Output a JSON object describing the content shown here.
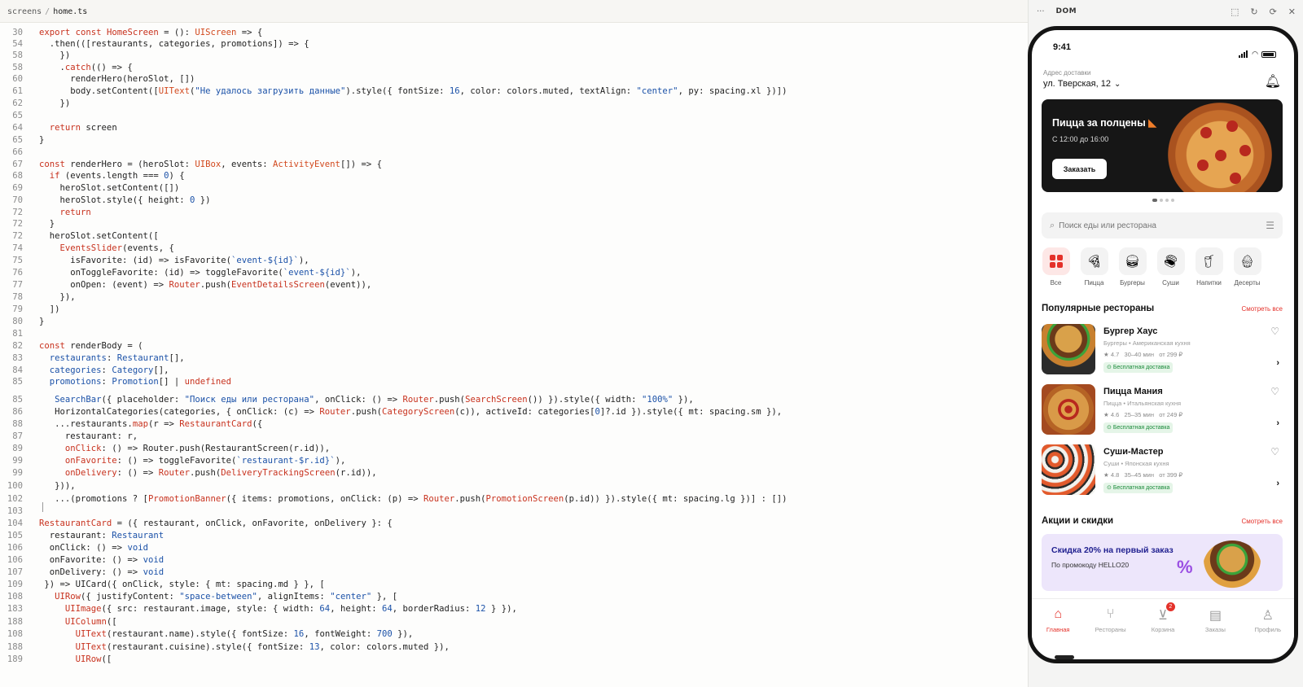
{
  "editor": {
    "breadcrumb": {
      "folder": "screens",
      "file": "home.ts"
    },
    "lines": [
      {
        "n": "30",
        "html": "<span class=\"kw\">export const</span> <span class=\"fn\">HomeScreen</span> = (): <span class=\"ty\">UIScreen</span> => {"
      },
      {
        "n": "54",
        "html": "  .then(([restaurants, categories, promotions]) => {"
      },
      {
        "n": "58",
        "html": "    })"
      },
      {
        "n": "58",
        "html": "    .<span class=\"fn\">catch</span>(() => {"
      },
      {
        "n": "60",
        "html": "      renderHero(heroSlot, [])"
      },
      {
        "n": "61",
        "html": "      body.setContent([<span class=\"ty\">UIText</span>(<span class=\"str\">\"Не удалось загрузить данные\"</span>).style({ fontSize: <span class=\"num\">16</span>, color: colors.muted, textAlign: <span class=\"str\">\"center\"</span>, py: spacing.xl })])"
      },
      {
        "n": "62",
        "html": "    })"
      },
      {
        "n": "65",
        "html": ""
      },
      {
        "n": "64",
        "html": "  <span class=\"kw\">return</span> screen"
      },
      {
        "n": "65",
        "html": "}"
      },
      {
        "n": "66",
        "html": ""
      },
      {
        "n": "67",
        "html": "<span class=\"kw\">const</span> renderHero = (heroSlot: <span class=\"ty\">UIBox</span>, events: <span class=\"ty\">ActivityEvent</span>[]) => {"
      },
      {
        "n": "68",
        "html": "  <span class=\"kw\">if</span> (events.length === <span class=\"num\">0</span>) {"
      },
      {
        "n": "69",
        "html": "    heroSlot.setContent([])"
      },
      {
        "n": "70",
        "html": "    heroSlot.style({ height: <span class=\"num\">0</span> })"
      },
      {
        "n": "72",
        "html": "    <span class=\"kw\">return</span>"
      },
      {
        "n": "72",
        "html": "  }"
      },
      {
        "n": "72",
        "html": "  heroSlot.setContent(["
      },
      {
        "n": "74",
        "html": "    <span class=\"fn\">EventsSlider</span>(events, {"
      },
      {
        "n": "75",
        "html": "      isFavorite: (id) => isFavorite(<span class=\"str\">`event-${id}`</span>),"
      },
      {
        "n": "76",
        "html": "      onToggleFavorite: (id) => toggleFavorite(<span class=\"str\">`event-${id}`</span>),"
      },
      {
        "n": "77",
        "html": "      onOpen: (event) => <span class=\"fn\">Router</span>.push(<span class=\"fn\">EventDetailsScreen</span>(event)),"
      },
      {
        "n": "78",
        "html": "    }),"
      },
      {
        "n": "79",
        "html": "  ])"
      },
      {
        "n": "80",
        "html": "}"
      },
      {
        "n": "81",
        "html": ""
      },
      {
        "n": "82",
        "html": "<span class=\"kw\">const</span> renderBody = ("
      },
      {
        "n": "83",
        "html": "  <span class=\"str\">restaurants</span>: <span class=\"str\">Restaurant</span>[],"
      },
      {
        "n": "84",
        "html": "  <span class=\"str\">categories</span>: <span class=\"str\">Category</span>[],"
      },
      {
        "n": "85",
        "html": "  <span class=\"str\">promotions</span>: <span class=\"str\">Promotion</span>[] | <span class=\"kw\">undefined</span>"
      },
      {
        "n": "85",
        "html": "   <span class=\"str\">SearchBar</span>({ placeholder: <span class=\"str\">\"Поиск еды или ресторана\"</span>, onClick: () => <span class=\"fn\">Router</span>.push(<span class=\"fn\">SearchScreen</span>()) }).style({ width: <span class=\"str\">\"100%\"</span> }),"
      },
      {
        "n": "86",
        "html": "   HorizontalCategories(categories, { onClick: (c) => <span class=\"fn\">Router</span>.push(<span class=\"fn\">CategoryScreen</span>(c)), activeId: categories[<span class=\"num\">0</span>]?.id }).style({ mt: spacing.sm }),"
      },
      {
        "n": "88",
        "html": "   ...restaurants.<span class=\"fn\">map</span>(r => <span class=\"fn\">RestaurantCard</span>({"
      },
      {
        "n": "87",
        "html": "     restaurant: r,"
      },
      {
        "n": "89",
        "html": "     <span class=\"fn\">onClick</span>: () => Router.push(RestaurantScreen(r.id)),"
      },
      {
        "n": "99",
        "html": "     <span class=\"fn\">onFavorite</span>: () => toggleFavorite(<span class=\"str\">`restaurant-$r.id}`</span>),"
      },
      {
        "n": "99",
        "html": "     <span class=\"fn\">onDelivery</span>: () => <span class=\"fn\">Router</span>.push(<span class=\"fn\">DeliveryTrackingScreen</span>(r.id)),"
      },
      {
        "n": "100",
        "html": "   })),"
      },
      {
        "n": "102",
        "html": "   ...(promotions ? [<span class=\"fn\">PromotionBanner</span>({ items: promotions, onClick: (p) => <span class=\"fn\">Router</span>.push(<span class=\"fn\">PromotionScreen</span>(p.id)) }).style({ mt: spacing.lg })] : [])"
      },
      {
        "n": "103",
        "html": ""
      },
      {
        "n": "104",
        "html": "<span class=\"fn\">RestaurantCard</span> = ({ restaurant, onClick, onFavorite, onDelivery }: {"
      },
      {
        "n": "105",
        "html": "  restaurant: <span class=\"str\">Restaurant</span>"
      },
      {
        "n": "106",
        "html": "  onClick: () => <span class=\"str\">void</span>"
      },
      {
        "n": "106",
        "html": "  onFavorite: () => <span class=\"str\">void</span>"
      },
      {
        "n": "107",
        "html": "  onDelivery: () => <span class=\"str\">void</span>"
      },
      {
        "n": "109",
        "html": " }) => UICard({ onClick, style: { mt: spacing.md } }, ["
      },
      {
        "n": "108",
        "html": "   <span class=\"fn\">UIRow</span>({ justifyContent: <span class=\"str\">\"space-between\"</span>, alignItems: <span class=\"str\">\"center\"</span> }, ["
      },
      {
        "n": "183",
        "html": "     <span class=\"fn\">UIImage</span>({ src: restaurant.image, style: { width: <span class=\"num\">64</span>, height: <span class=\"num\">64</span>, borderRadius: <span class=\"num\">12</span> } }),"
      },
      {
        "n": "188",
        "html": "     <span class=\"fn\">UIColumn</span>(["
      },
      {
        "n": "108",
        "html": "       <span class=\"fn\">UIText</span>(restaurant.name).style({ fontSize: <span class=\"num\">16</span>, fontWeight: <span class=\"num\">700</span> }),"
      },
      {
        "n": "188",
        "html": "       <span class=\"fn\">UIText</span>(restaurant.cuisine).style({ fontSize: <span class=\"num\">13</span>, color: colors.muted }),"
      },
      {
        "n": "189",
        "html": "       <span class=\"fn\">UIRow</span>(["
      }
    ]
  },
  "dom_panel": {
    "menu": "···",
    "title": "DOM"
  },
  "phone": {
    "time": "9:41",
    "address_label": "Адрес доставки",
    "address": "ул. Тверская, 12",
    "hero": {
      "title": "Пицца за полцены",
      "subtitle": "С 12:00 до 16:00",
      "button": "Заказать"
    },
    "search_placeholder": "Поиск еды или ресторана",
    "categories": [
      {
        "label": "Все",
        "icon": "grid-icon"
      },
      {
        "label": "Пицца",
        "icon": "pizza-icon"
      },
      {
        "label": "Бургеры",
        "icon": "burger-icon"
      },
      {
        "label": "Суши",
        "icon": "sushi-icon"
      },
      {
        "label": "Напитки",
        "icon": "drink-icon"
      },
      {
        "label": "Десерты",
        "icon": "dessert-icon"
      }
    ],
    "popular": {
      "title": "Популярные рестораны",
      "link": "Смотреть все"
    },
    "restaurants": [
      {
        "name": "Бургер Хаус",
        "cuisine": "Бургеры • Американская кухня",
        "rating": "4.7",
        "time": "30–40 мин",
        "price": "от 299 ₽",
        "badge": "Бесплатная доставка"
      },
      {
        "name": "Пицца Мания",
        "cuisine": "Пицца • Итальянская кухня",
        "rating": "4.6",
        "time": "25–35 мин",
        "price": "от 249 ₽",
        "badge": "Бесплатная доставка"
      },
      {
        "name": "Суши-Мастер",
        "cuisine": "Суши • Японская кухня",
        "rating": "4.8",
        "time": "35–45 мин",
        "price": "от 399 ₽",
        "badge": "Бесплатная доставка"
      }
    ],
    "promos": {
      "title": "Акции и скидки",
      "link": "Смотреть все"
    },
    "promo_banner": {
      "title": "Скидка 20% на первый заказ",
      "subtitle": "По промокоду HELLO20"
    },
    "tabs": [
      {
        "label": "Главная",
        "icon": "home-icon"
      },
      {
        "label": "Рестораны",
        "icon": "utensils-icon"
      },
      {
        "label": "Корзина",
        "icon": "cart-icon",
        "badge": "2"
      },
      {
        "label": "Заказы",
        "icon": "orders-icon"
      },
      {
        "label": "Профиль",
        "icon": "profile-icon"
      }
    ],
    "colors": {
      "accent": "#e4312a",
      "promo_bg": "#ede6fb",
      "badge_green": "#1a8a3a"
    }
  }
}
